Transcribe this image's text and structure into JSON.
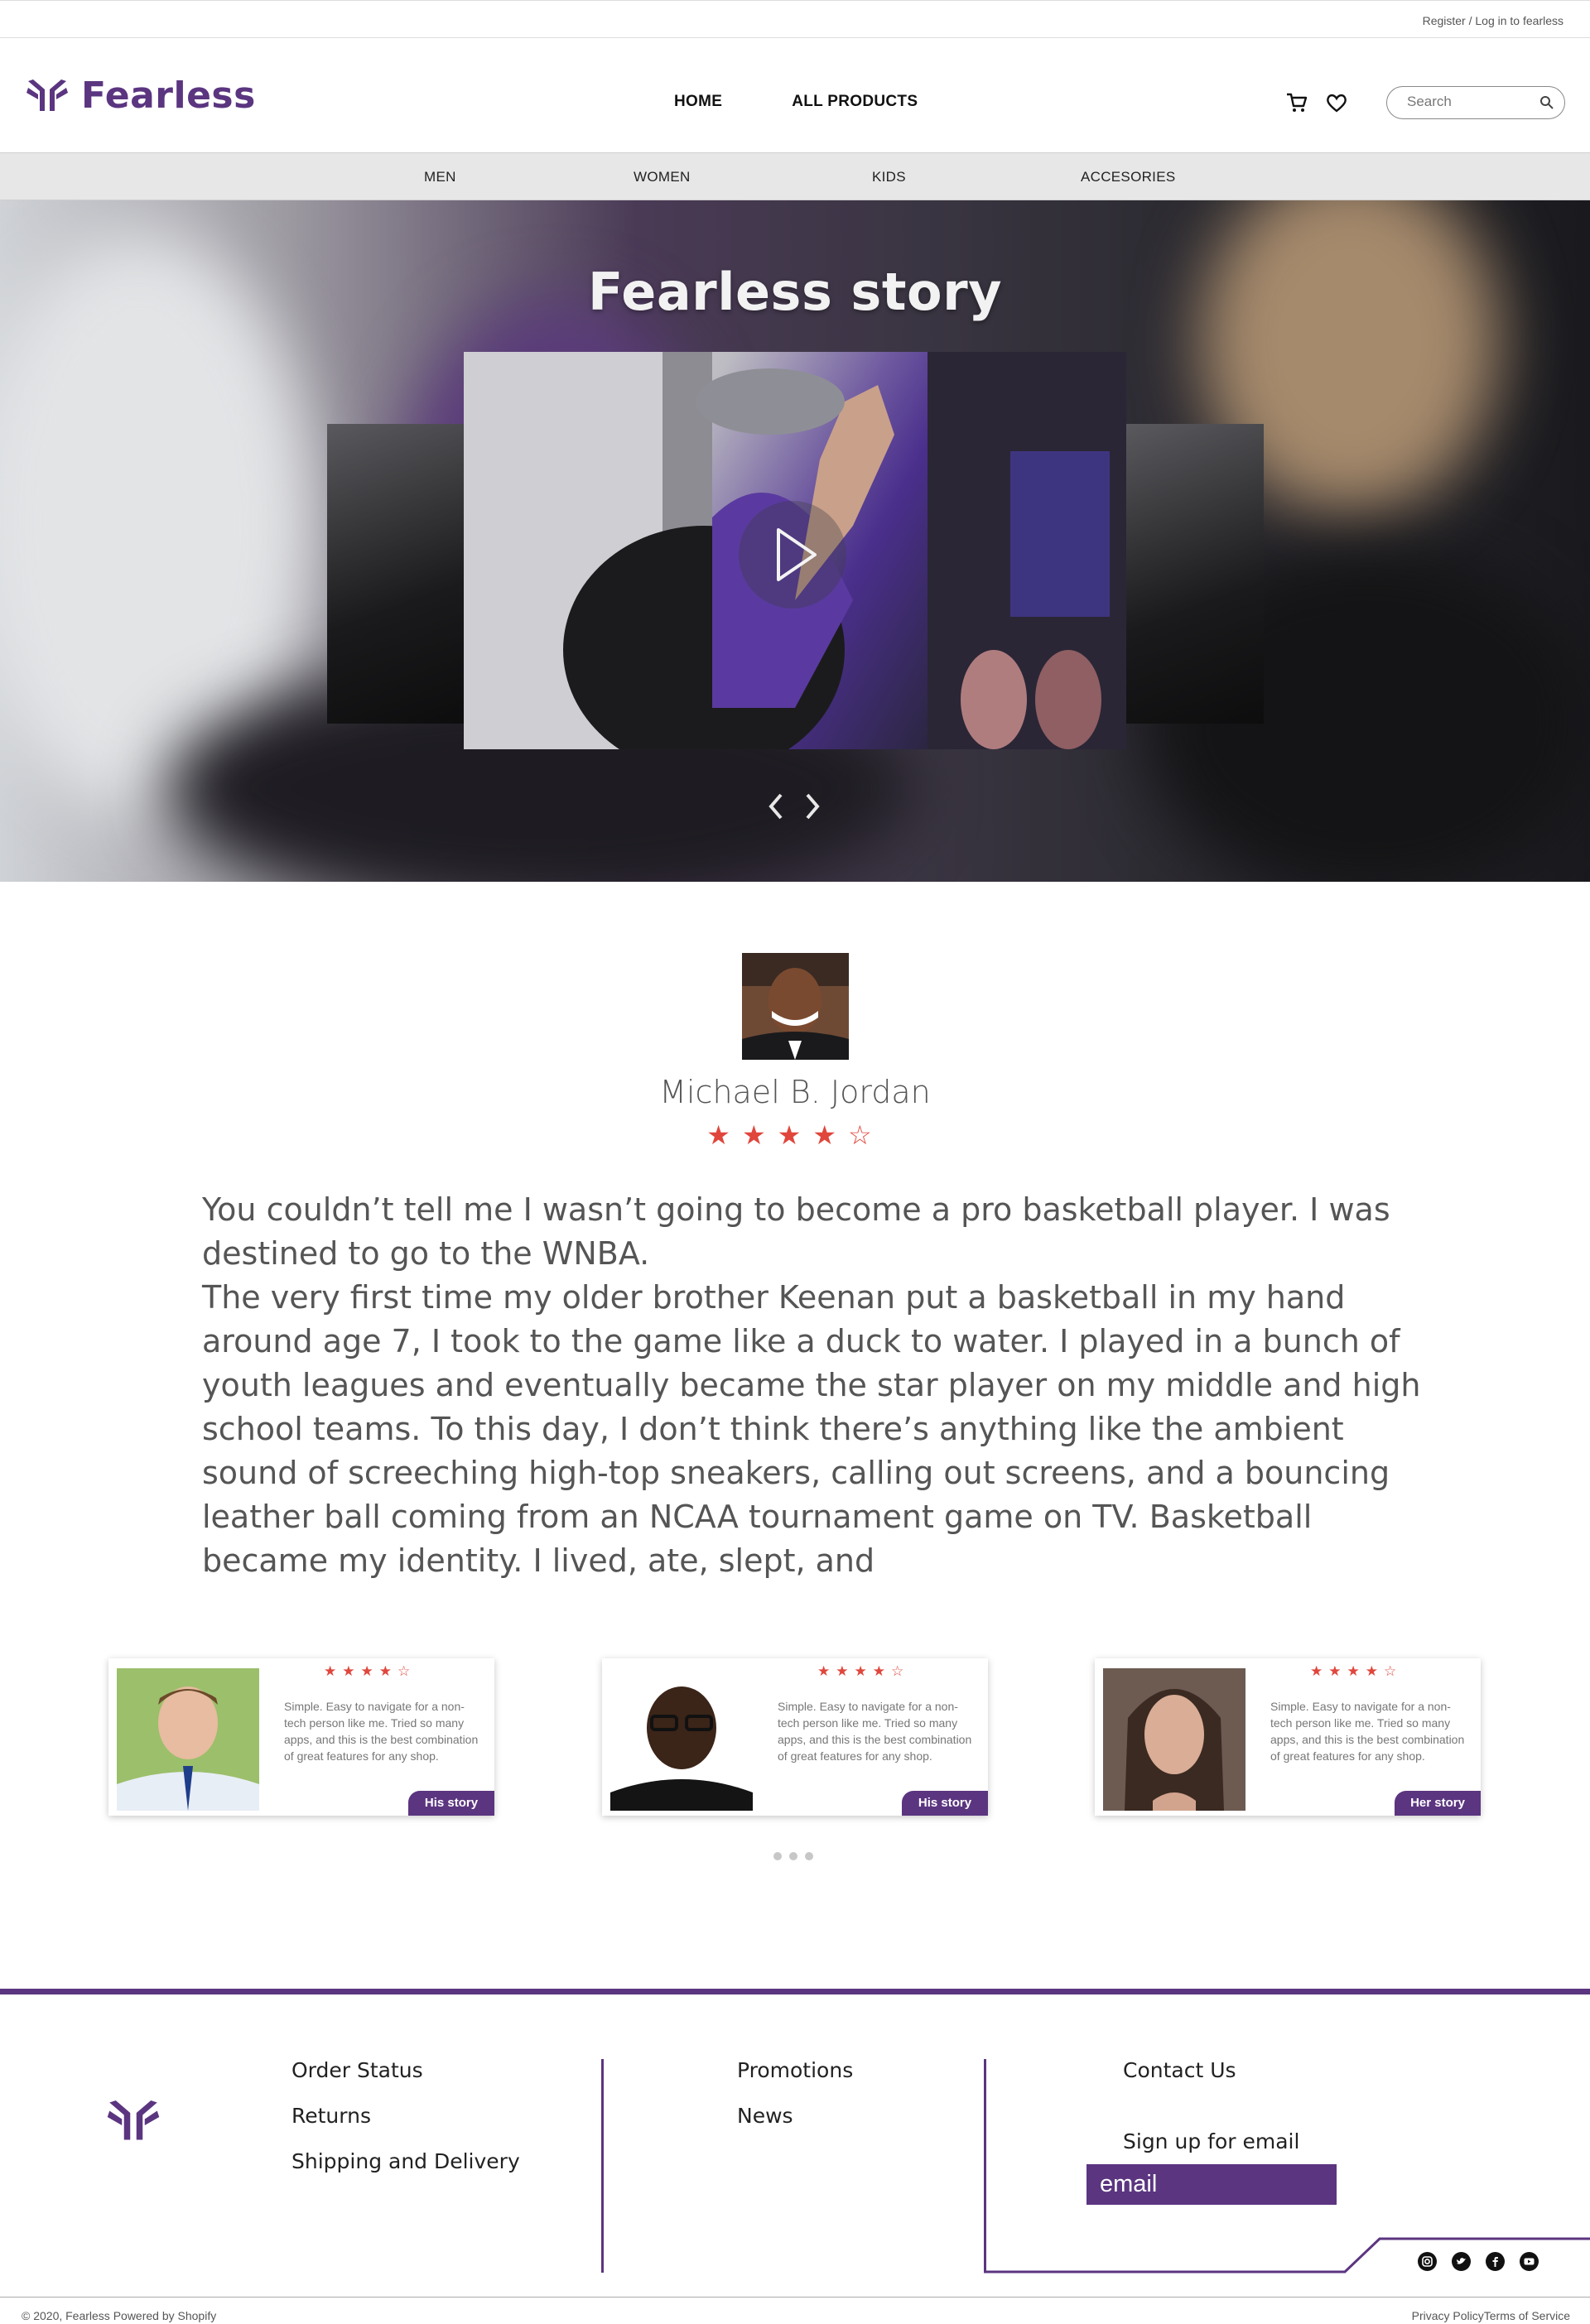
{
  "topbar": {
    "register_text": "Register / Log in to fearless"
  },
  "header": {
    "brand": "Fearless",
    "nav": [
      "HOME",
      "ALL PRODUCTS"
    ],
    "search_placeholder": "Search"
  },
  "categories": [
    "MEN",
    "WOMEN",
    "KIDS",
    "ACCESORIES"
  ],
  "hero": {
    "title": "Fearless story"
  },
  "story": {
    "name": "Michael B. Jordan",
    "rating": 4,
    "stars_display": "★★★★☆",
    "paragraphs": [
      "You couldn’t tell me I wasn’t going to become a pro basketball player. I was destined to go to the WNBA.",
      "The very first time my older brother Keenan put a basketball in my hand around age 7, I took to the game like a duck to water. I played in a bunch of youth leagues and eventually became the star player on my middle and high school teams. To this day, I don’t think there’s anything like the ambient sound of screeching high-top sneakers, calling out screens, and a bouncing leather ball coming from an NCAA tournament game on TV. Basketball became my identity. I lived, ate, slept, and"
    ]
  },
  "testimonials": [
    {
      "stars": "★★★★☆",
      "text": "Simple. Easy to navigate for a non-tech person like me. Tried so many apps, and this is the best combination of great features for any shop.",
      "button": "His story"
    },
    {
      "stars": "★★★★☆",
      "text": "Simple. Easy to navigate for a non-tech person like me. Tried so many apps, and this is the best combination of great features for any shop.",
      "button": "His story"
    },
    {
      "stars": "★★★★☆",
      "text": "Simple. Easy to navigate for a non-tech person like me. Tried so many apps, and this is the best combination of great features for any shop.",
      "button": "Her story"
    }
  ],
  "footer": {
    "col1": [
      "Order Status",
      "Returns",
      "Shipping and Delivery"
    ],
    "col2": [
      "Promotions",
      "News"
    ],
    "contact": "Contact Us",
    "signup_label": "Sign up for email",
    "email_placeholder": "email",
    "social_icons": [
      "instagram-icon",
      "twitter-icon",
      "facebook-icon",
      "youtube-icon"
    ],
    "copyright": "© 2020, Fearless Powered by Shopify",
    "legal": [
      "Privacy Policy",
      "Terms of Service"
    ]
  },
  "colors": {
    "brand": "#5b3580",
    "star": "#e0463c"
  }
}
